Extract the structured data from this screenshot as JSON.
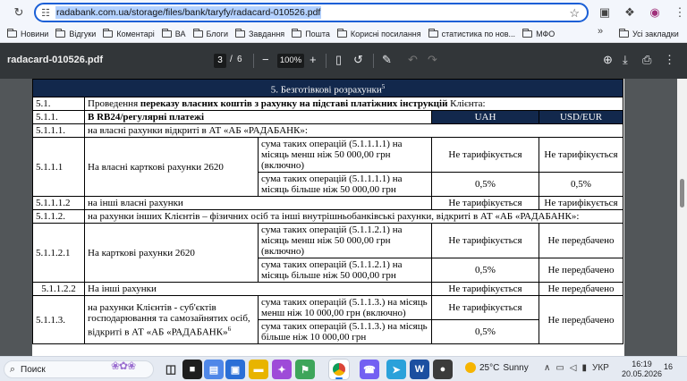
{
  "browser": {
    "url": "radabank.com.ua/storage/files/bank/taryfy/radacard-010526.pdf",
    "bookmarks": [
      "Новини",
      "Відгуки",
      "Коментарі",
      "ВА",
      "Блоги",
      "Завдання",
      "Пошта",
      "Корисні посилання",
      "статистика по нов...",
      "МФО"
    ],
    "more": "»",
    "all_bookmarks": "Усі закладки"
  },
  "pdf": {
    "title": "radacard-010526.pdf",
    "page": "3",
    "page_sep": "/",
    "total": "6",
    "zoom": "100%"
  },
  "doc": {
    "section_header": "5. Безготівкові розрахунки",
    "section_sup": "5",
    "r1_num": "5.1.",
    "r1_pre": "Проведення ",
    "r1_bold": "переказу власних коштів з рахунку на підставі платіжних інструкцій",
    "r1_post": " Клієнта:",
    "r2_num": "5.1.1.",
    "r2_text": "В RB24/регулярні платежі",
    "col_uah": "UAH",
    "col_usd": "USD/EUR",
    "r3_num": "5.1.1.1.",
    "r3_text": "на власні рахунки відкриті в АТ «АБ «РАДАБАНК»:",
    "r4_num": "5.1.1.1",
    "r4_text": "На власні карткові рахунки 2620",
    "r4a_cond": "сума таких операцій (5.1.1.1.1) на місяць менш ніж 50 000,00 грн (включно)",
    "r4a_uah": "Не тарифікується",
    "r4a_usd": "Не тарифікується",
    "r4b_cond": "сума таких операцій (5.1.1.1.1) на місяць більше ніж 50 000,00 грн",
    "r4b_uah": "0,5%",
    "r4b_usd": "0,5%",
    "r5_num": "5.1.1.1.2",
    "r5_text": "на інші власні рахунки",
    "r5_uah": "Не тарифікується",
    "r5_usd": "Не тарифікується",
    "r6_num": "5.1.1.2.",
    "r6_text": "на рахунки інших Клієнтів – фізичних осіб та інші внутрішньобанківські рахунки, відкриті в АТ «АБ «РАДАБАНК»:",
    "r7_num": "5.1.1.2.1",
    "r7_text": "На карткові рахунки 2620",
    "r7a_cond": "сума таких операцій (5.1.1.2.1) на місяць менш ніж 50 000,00 грн (включно)",
    "r7a_uah": "Не тарифікується",
    "r7a_usd": "Не передбачено",
    "r7b_cond": "сума таких операцій (5.1.1.2.1) на місяць більше ніж 50 000,00 грн",
    "r7b_uah": "0,5%",
    "r7b_usd": "Не передбачено",
    "r8_num": "5.1.1.2.2",
    "r8_text": "На інші рахунки",
    "r8_uah": "Не тарифікується",
    "r8_usd": "Не передбачено",
    "r9_num": "5.1.1.3.",
    "r9_text": "на рахунки Клієнтів - суб'єктів господарювання та самозайнятих осіб, відкриті в АТ «АБ «РАДАБАНК»",
    "r9_sup": "6",
    "r9a_cond": "сума таких операцій (5.1.1.3.) на місяць менш ніж 10 000,00 грн (включно)",
    "r9a_uah": "Не тарифікується",
    "r9_usd": "Не передбачено",
    "r9b_cond": "сума таких операцій (5.1.1.3.) на місяць більше ніж 10 000,00 грн",
    "r9b_uah": "0,5%"
  },
  "taskbar": {
    "search": "Поиск",
    "weather_temp": "25°C",
    "weather_text": "Sunny",
    "lang": "УКР",
    "time": "16:19",
    "date": "20.05.2026",
    "notifications": "16"
  }
}
